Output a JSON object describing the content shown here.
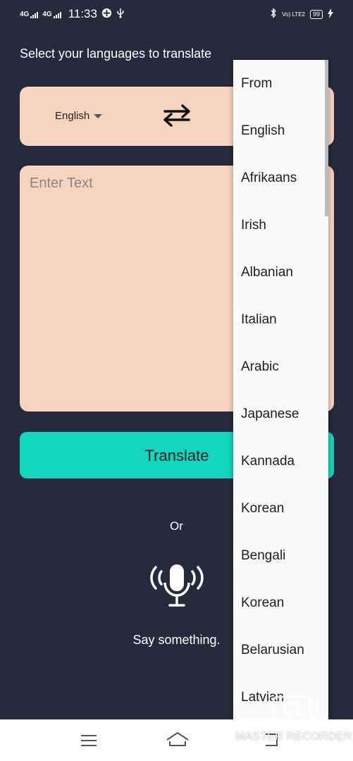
{
  "status_bar": {
    "network1": "4G",
    "network2": "4G",
    "time": "11:33",
    "volte": "Vo) LTE2",
    "battery": "99"
  },
  "heading": "Select your languages to translate",
  "lang_selector": {
    "from_value": "English"
  },
  "input": {
    "placeholder": "Enter Text"
  },
  "translate_button": "Translate",
  "or_text": "Or",
  "voice_prompt": "Say something.",
  "dropdown": {
    "items": [
      "From",
      "English",
      "Afrikaans",
      "Irish",
      "Albanian",
      "Italian",
      "Arabic",
      "Japanese",
      "Kannada",
      "Korean",
      "Bengali",
      "Korean",
      "Belarusian",
      "Latvian"
    ]
  },
  "watermark": "MASTER RECORDER",
  "colors": {
    "background": "#272a3c",
    "card": "#f7d4c0",
    "accent": "#13d6c0"
  },
  "icons": {
    "swap": "swap-arrows-icon",
    "mic": "microphone-icon",
    "menu": "menu-icon",
    "home": "home-icon",
    "back": "back-icon"
  }
}
